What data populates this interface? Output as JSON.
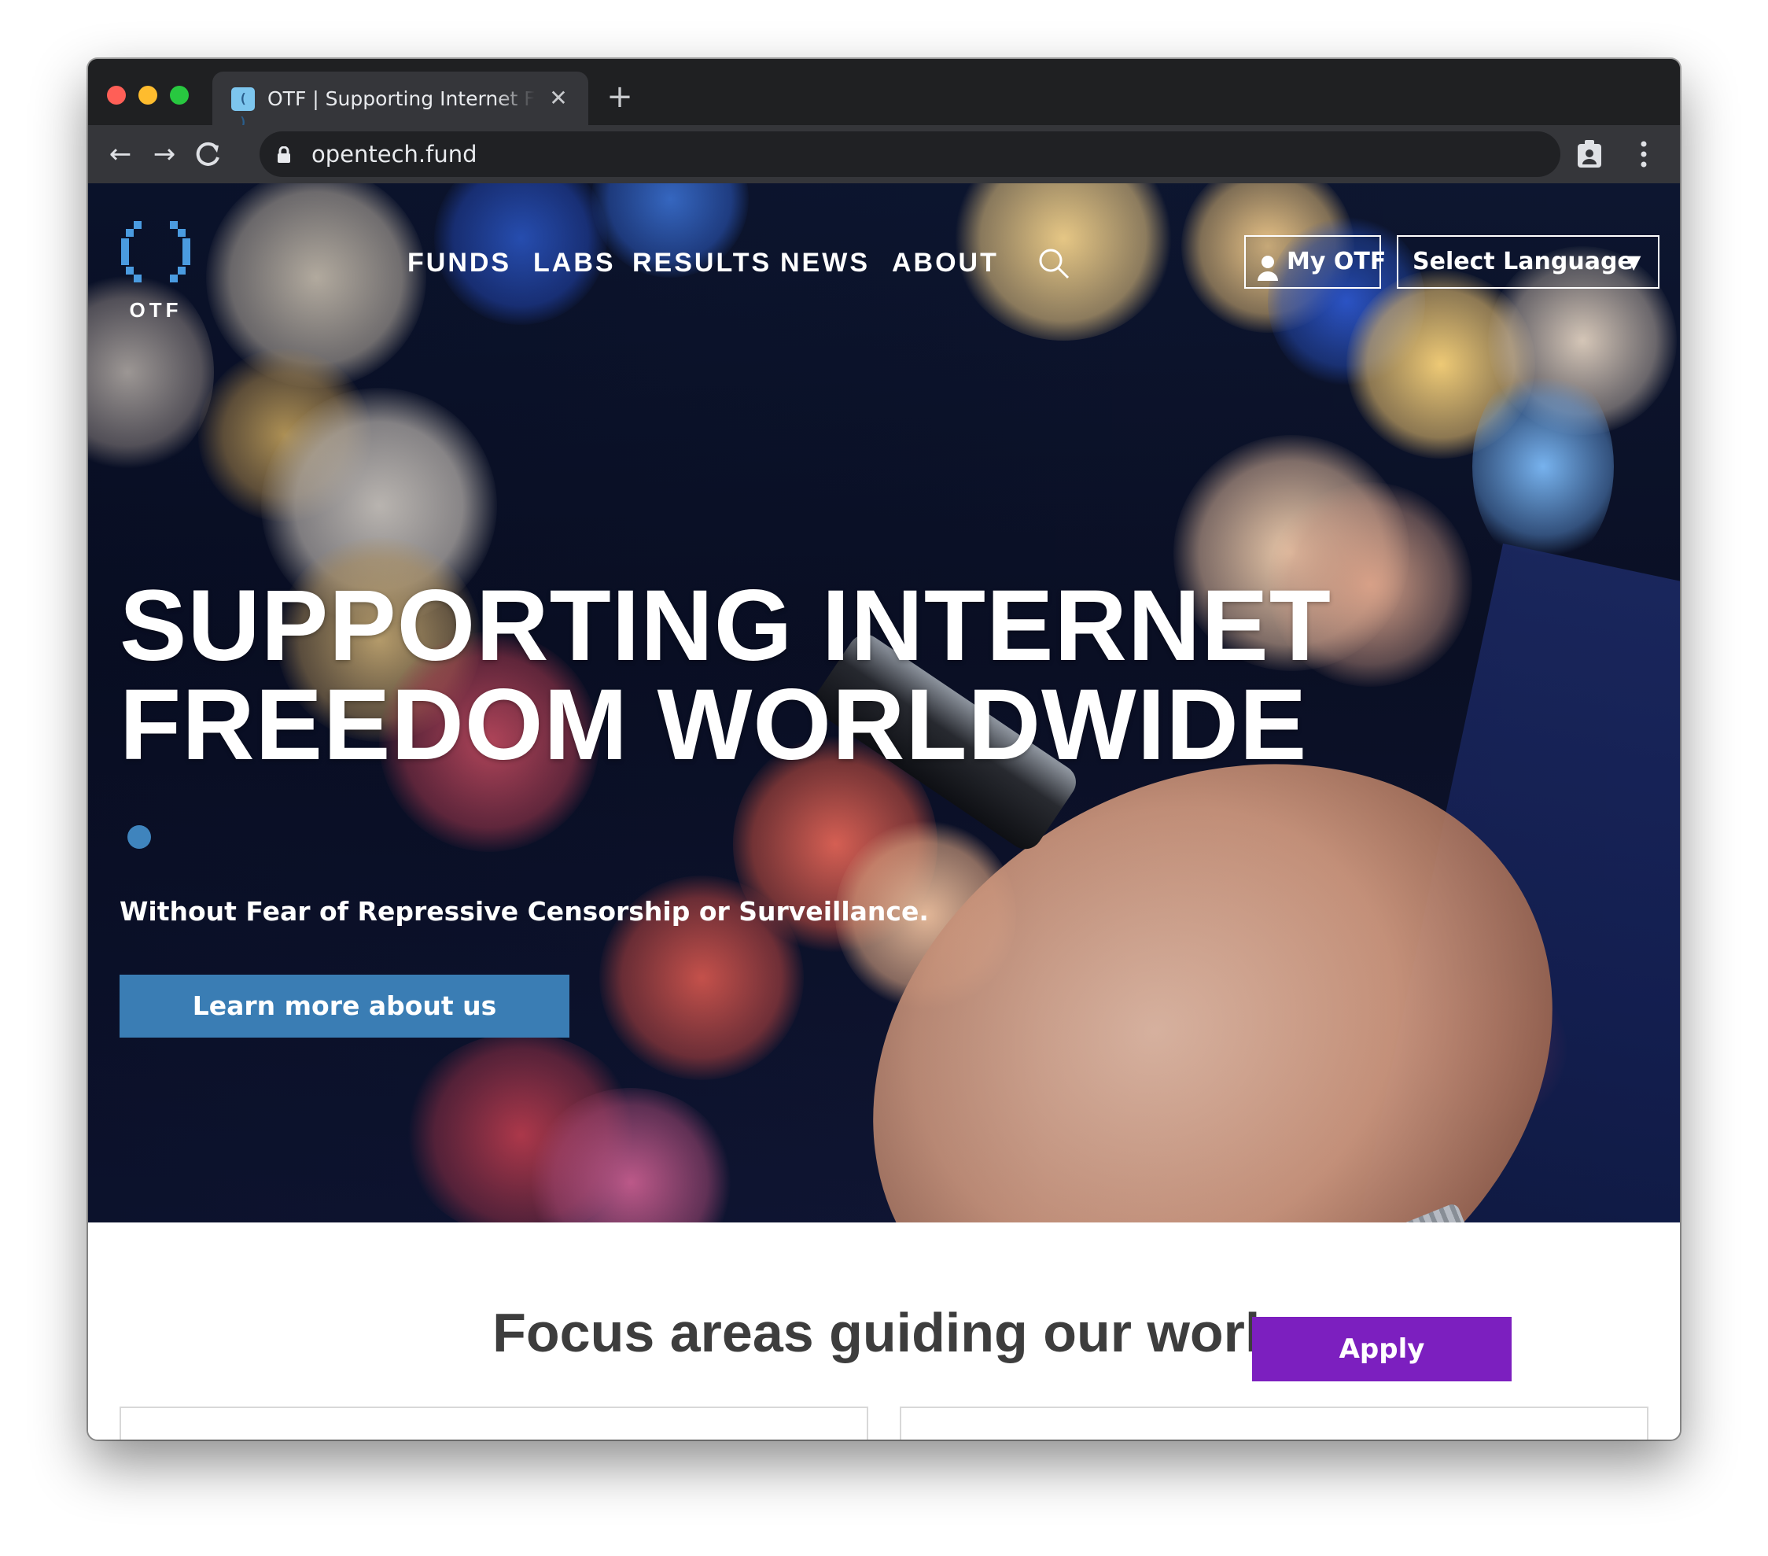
{
  "browser": {
    "tab_title": "OTF | Supporting Internet Freedom Worldwide",
    "favicon": "bracket-logo-icon",
    "url": "opentech.fund",
    "colors": {
      "frame": "#202124",
      "toolbar": "#35363a"
    }
  },
  "site": {
    "logo_text": "OTF",
    "nav": [
      {
        "label": "FUNDS"
      },
      {
        "label": "LABS"
      },
      {
        "label": "RESULTS"
      },
      {
        "label": "NEWS"
      },
      {
        "label": "ABOUT"
      }
    ],
    "my_otf_label": "My OTF",
    "language_label": "Select Language",
    "language_caret": "▼"
  },
  "hero": {
    "headline_line1": "SUPPORTING INTERNET",
    "headline_line2": "FREEDOM WORLDWIDE",
    "tagline": "Without Fear of Repressive Censorship or Surveillance.",
    "cta_label": "Learn more about us",
    "colors": {
      "cta": "#3a7db4",
      "slide_dot": "#3f84bd"
    }
  },
  "content": {
    "section_title": "Focus areas guiding our work"
  },
  "apply_label": "Apply",
  "colors": {
    "apply": "#7c1fbf"
  }
}
